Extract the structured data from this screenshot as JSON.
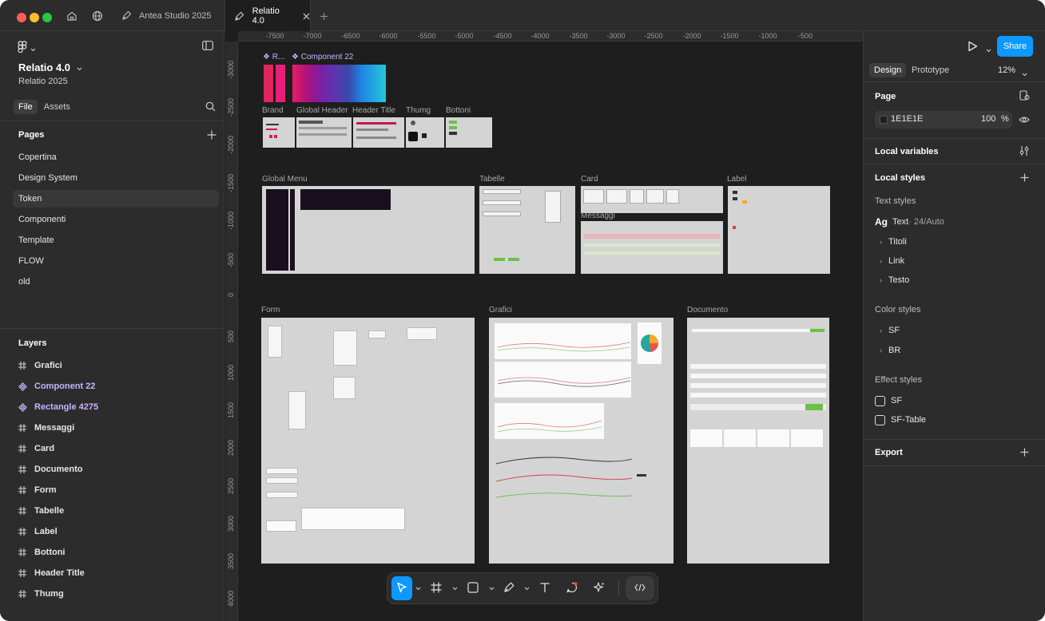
{
  "titlebar": {
    "tabs": [
      {
        "label": "Antea Studio 2025",
        "active": false
      },
      {
        "label": "Relatio 4.0",
        "active": true
      }
    ]
  },
  "left_panel": {
    "file_title": "Relatio 4.0",
    "file_subtitle": "Relatio 2025",
    "tabs": [
      "File",
      "Assets"
    ],
    "pages_title": "Pages",
    "pages": [
      "Copertina",
      "Design System",
      "Token",
      "Componenti",
      "Template",
      "FLOW",
      "old"
    ],
    "active_page": "Token",
    "layers_title": "Layers",
    "layers": [
      {
        "label": "Grafici",
        "icon": "frame-icon"
      },
      {
        "label": "Component 22",
        "icon": "component-icon"
      },
      {
        "label": "Rectangle 4275",
        "icon": "component-icon"
      },
      {
        "label": "Messaggi",
        "icon": "frame-icon"
      },
      {
        "label": "Card",
        "icon": "frame-icon"
      },
      {
        "label": "Documento",
        "icon": "frame-icon"
      },
      {
        "label": "Form",
        "icon": "frame-icon"
      },
      {
        "label": "Tabelle",
        "icon": "frame-icon"
      },
      {
        "label": "Label",
        "icon": "frame-icon"
      },
      {
        "label": "Bottoni",
        "icon": "frame-icon"
      },
      {
        "label": "Header Title",
        "icon": "frame-icon"
      },
      {
        "label": "Thumg",
        "icon": "frame-icon"
      }
    ]
  },
  "canvas": {
    "ruler_top": [
      "-7500",
      "-7000",
      "-6500",
      "-6000",
      "-5500",
      "-5000",
      "-4500",
      "-4000",
      "-3500",
      "-3000",
      "-2500",
      "-2000",
      "-1500",
      "-1000",
      "-500"
    ],
    "ruler_left": [
      "-3000",
      "-2500",
      "-2000",
      "-1500",
      "-1000",
      "-500",
      "0",
      "500",
      "1000",
      "1500",
      "2000",
      "2500",
      "3000",
      "3500",
      "4000"
    ],
    "frames": {
      "r_label": "R...",
      "component22": "Component 22",
      "brand": "Brand",
      "global_header": "Global Header",
      "header_title": "Header Title",
      "thumg": "Thumg",
      "bottoni": "Bottoni",
      "global_menu": "Global Menu",
      "tabelle": "Tabelle",
      "card": "Card",
      "messaggi": "Messaggi",
      "label": "Label",
      "form": "Form",
      "grafici": "Grafici",
      "documento": "Documento"
    },
    "gradient_colors": [
      "#e91e63",
      "#9c27b0",
      "#673ab7",
      "#3f51b5",
      "#2196f3",
      "#26c6da"
    ]
  },
  "toolbar": {
    "tools": [
      "move-tool",
      "frame-tool",
      "rectangle-tool",
      "pen-tool",
      "text-tool",
      "comment-tool",
      "actions-tool",
      "dev-mode-toggle"
    ]
  },
  "right_panel": {
    "share_label": "Share",
    "tabs": [
      "Design",
      "Prototype"
    ],
    "zoom": "12%",
    "page_title": "Page",
    "page_color": "1E1E1E",
    "page_opacity": "100",
    "percent": "%",
    "local_variables": "Local variables",
    "local_styles": "Local styles",
    "text_styles_title": "Text styles",
    "text_style_ag": "Ag",
    "text_style_name": "Text",
    "text_style_spec": " · 24/Auto",
    "text_groups": [
      "Titoli",
      "Link",
      "Testo"
    ],
    "color_styles_title": "Color styles",
    "color_groups": [
      "SF",
      "BR"
    ],
    "effect_styles_title": "Effect styles",
    "effects": [
      "SF",
      "SF-Table"
    ],
    "export": "Export",
    "colors": {
      "accent": "#0d99ff",
      "panel": "#2c2c2c",
      "canvas": "#1e1e1e"
    }
  }
}
